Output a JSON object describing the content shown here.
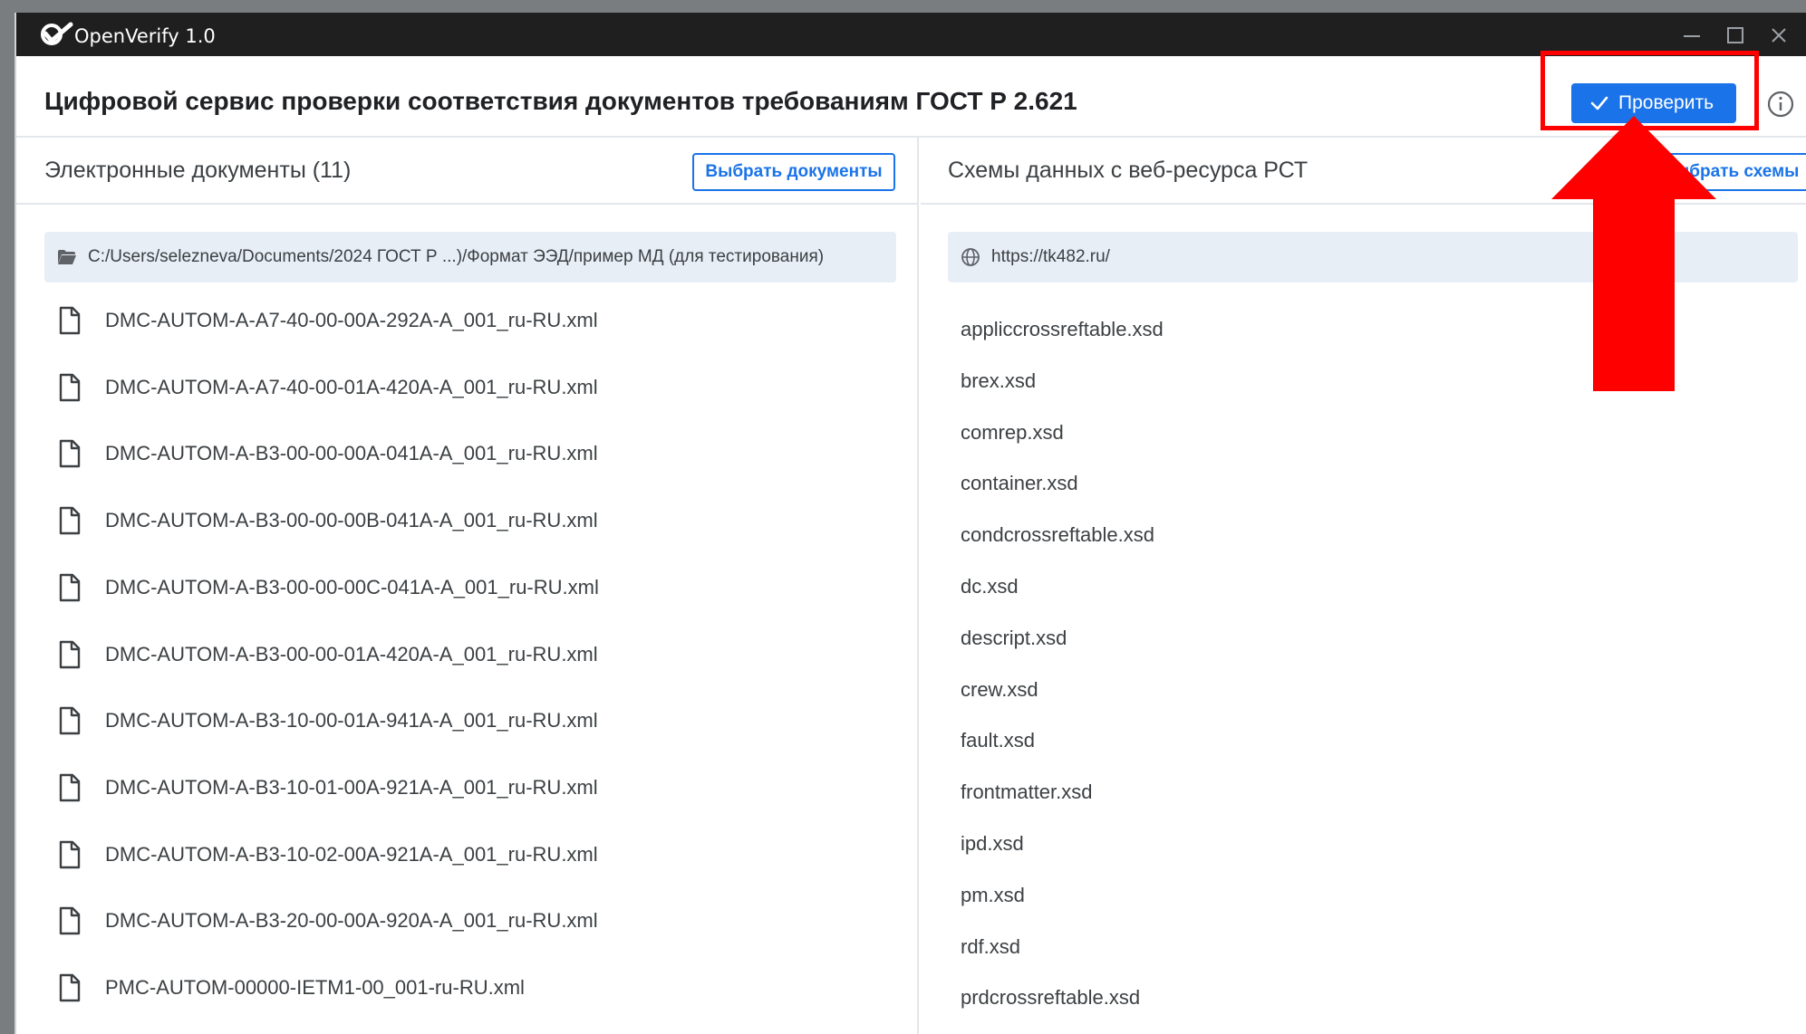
{
  "window": {
    "app_title": "OpenVerify 1.0",
    "controls": [
      "minimize-icon",
      "maximize-icon",
      "close-icon"
    ]
  },
  "header": {
    "title": "Цифровой сервис проверки соответствия документов требованиям ГОСТ Р 2.621",
    "check_button": "Проверить",
    "info_icon": "info-icon",
    "accent_color": "#1a73e8",
    "highlight_color": "#ff0000"
  },
  "documents_panel": {
    "title": "Электронные документы (11)",
    "select_button": "Выбрать документы",
    "path": "C:/Users/selezneva/Documents/2024 ГОСТ Р ...)/Формат ЭЭД/пример МД (для тестирования)",
    "items": [
      "DMC-AUTOM-A-A7-40-00-00A-292A-A_001_ru-RU.xml",
      "DMC-AUTOM-A-A7-40-00-01A-420A-A_001_ru-RU.xml",
      "DMC-AUTOM-A-B3-00-00-00A-041A-A_001_ru-RU.xml",
      "DMC-AUTOM-A-B3-00-00-00B-041A-A_001_ru-RU.xml",
      "DMC-AUTOM-A-B3-00-00-00C-041A-A_001_ru-RU.xml",
      "DMC-AUTOM-A-B3-00-00-01A-420A-A_001_ru-RU.xml",
      "DMC-AUTOM-A-B3-10-00-01A-941A-A_001_ru-RU.xml",
      "DMC-AUTOM-A-B3-10-01-00A-921A-A_001_ru-RU.xml",
      "DMC-AUTOM-A-B3-10-02-00A-921A-A_001_ru-RU.xml",
      "DMC-AUTOM-A-B3-20-00-00A-920A-A_001_ru-RU.xml",
      "PMC-AUTOM-00000-IETM1-00_001-ru-RU.xml"
    ]
  },
  "schemas_panel": {
    "title": "Схемы данных с веб-ресурса РСТ",
    "select_button": "ыбрать схемы",
    "url": "https://tk482.ru/",
    "items": [
      "appliccrossreftable.xsd",
      "brex.xsd",
      "comrep.xsd",
      "container.xsd",
      "condcrossreftable.xsd",
      "dc.xsd",
      "descript.xsd",
      "crew.xsd",
      "fault.xsd",
      "frontmatter.xsd",
      "ipd.xsd",
      "pm.xsd",
      "rdf.xsd",
      "prdcrossreftable.xsd"
    ]
  }
}
